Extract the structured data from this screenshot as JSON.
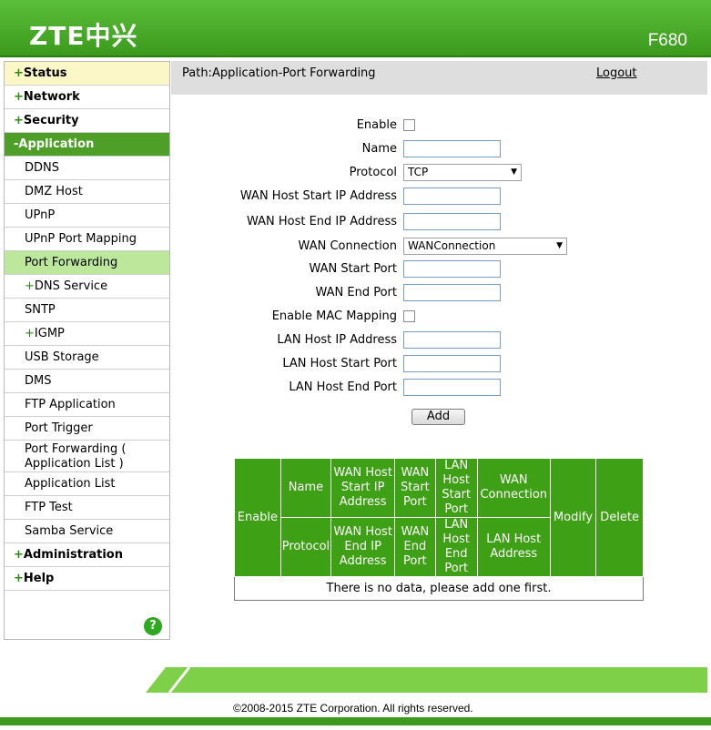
{
  "header": {
    "logo": "ZTE中兴",
    "model": "F680"
  },
  "sidebar": {
    "top": [
      {
        "label": "Status",
        "sign": "+"
      },
      {
        "label": "Network",
        "sign": "+"
      },
      {
        "label": "Security",
        "sign": "+"
      },
      {
        "label": "Application",
        "sign": "-"
      }
    ],
    "app_items": [
      {
        "label": "DDNS"
      },
      {
        "label": "DMZ Host"
      },
      {
        "label": "UPnP"
      },
      {
        "label": "UPnP Port Mapping"
      },
      {
        "label": "Port Forwarding"
      },
      {
        "label": "DNS Service",
        "sign": "+"
      },
      {
        "label": "SNTP"
      },
      {
        "label": "IGMP",
        "sign": "+"
      },
      {
        "label": "USB Storage"
      },
      {
        "label": "DMS"
      },
      {
        "label": "FTP Application"
      },
      {
        "label": "Port Trigger"
      },
      {
        "label": "Port Forwarding ( Application List )"
      },
      {
        "label": "Application List"
      },
      {
        "label": "FTP Test"
      },
      {
        "label": "Samba Service"
      }
    ],
    "bottom": [
      {
        "label": "Administration",
        "sign": "+"
      },
      {
        "label": "Help",
        "sign": "+"
      }
    ],
    "help_icon": "?"
  },
  "pathbar": {
    "path": "Path:Application-Port Forwarding",
    "logout": "Logout"
  },
  "form": {
    "enable_label": "Enable",
    "name_label": "Name",
    "protocol_label": "Protocol",
    "protocol_value": "TCP",
    "wan_start_ip_label": "WAN Host Start IP Address",
    "wan_end_ip_label": "WAN Host End IP Address",
    "wan_conn_label": "WAN Connection",
    "wan_conn_value": "WANConnection",
    "wan_start_port_label": "WAN Start Port",
    "wan_end_port_label": "WAN End Port",
    "mac_mapping_label": "Enable MAC Mapping",
    "lan_ip_label": "LAN Host IP Address",
    "lan_start_port_label": "LAN Host Start Port",
    "lan_end_port_label": "LAN Host End Port",
    "add_button": "Add"
  },
  "table": {
    "enable": "Enable",
    "name": "Name",
    "wan_start_ip": "WAN Host Start IP Address",
    "wan_start_port": "WAN Start Port",
    "lan_start_port": "LAN Host Start Port",
    "wan_connection": "WAN Connection",
    "modify": "Modify",
    "delete": "Delete",
    "protocol": "Protocol",
    "wan_end_ip": "WAN Host End IP Address",
    "wan_end_port": "WAN End Port",
    "lan_end_port": "LAN Host End Port",
    "lan_ip": "LAN Host Address",
    "empty_message": "There is no data, please add one first."
  },
  "footer": {
    "copyright": "©2008-2015 ZTE Corporation. All rights reserved."
  }
}
